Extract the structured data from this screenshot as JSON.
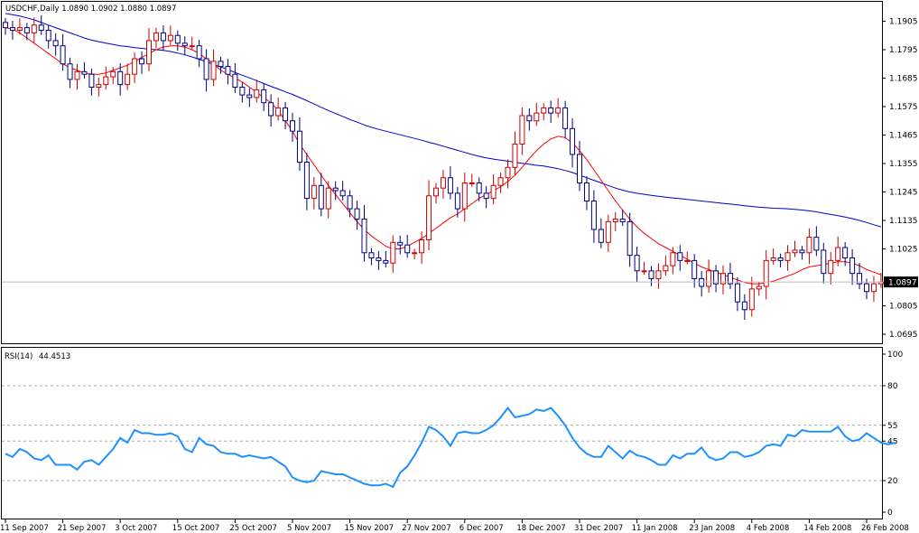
{
  "chart_data": [
    {
      "type": "candlestick",
      "symbol_line": "USDCHF,Daily  1.0890 1.0902 1.0880 1.0897",
      "ylim": [
        1.066,
        1.198
      ],
      "y_ticks": [
        "1.1905",
        "1.1795",
        "1.1685",
        "1.1575",
        "1.1465",
        "1.1355",
        "1.1245",
        "1.1135",
        "1.1025",
        "1.0805",
        "1.0695"
      ],
      "current_price_label": "1.0897",
      "current_price": 1.0897,
      "x_tick_labels": [
        {
          "label": "11 Sep 2007",
          "bar": 0
        },
        {
          "label": "21 Sep 2007",
          "bar": 8
        },
        {
          "label": "3 Oct 2007",
          "bar": 16
        },
        {
          "label": "15 Oct 2007",
          "bar": 24
        },
        {
          "label": "25 Oct 2007",
          "bar": 32
        },
        {
          "label": "5 Nov 2007",
          "bar": 40
        },
        {
          "label": "15 Nov 2007",
          "bar": 48
        },
        {
          "label": "27 Nov 2007",
          "bar": 56
        },
        {
          "label": "6 Dec 2007",
          "bar": 64
        },
        {
          "label": "18 Dec 2007",
          "bar": 72
        },
        {
          "label": "31 Dec 2007",
          "bar": 80
        },
        {
          "label": "11 Jan 2008",
          "bar": 88
        },
        {
          "label": "23 Jan 2008",
          "bar": 96
        },
        {
          "label": "4 Feb 2008",
          "bar": 104
        },
        {
          "label": "14 Feb 2008",
          "bar": 112
        },
        {
          "label": "26 Feb 2008",
          "bar": 120
        }
      ],
      "close": [
        1.188,
        1.187,
        1.188,
        1.186,
        1.189,
        1.187,
        1.183,
        1.181,
        1.174,
        1.168,
        1.171,
        1.17,
        1.165,
        1.166,
        1.169,
        1.171,
        1.166,
        1.17,
        1.176,
        1.174,
        1.183,
        1.186,
        1.183,
        1.185,
        1.182,
        1.181,
        1.181,
        1.176,
        1.168,
        1.175,
        1.173,
        1.17,
        1.165,
        1.162,
        1.161,
        1.164,
        1.159,
        1.154,
        1.157,
        1.152,
        1.148,
        1.136,
        1.122,
        1.127,
        1.118,
        1.126,
        1.125,
        1.123,
        1.118,
        1.114,
        1.101,
        1.099,
        1.098,
        1.097,
        1.105,
        1.104,
        1.101,
        1.101,
        1.106,
        1.123,
        1.126,
        1.13,
        1.124,
        1.118,
        1.128,
        1.128,
        1.124,
        1.122,
        1.127,
        1.13,
        1.134,
        1.143,
        1.154,
        1.152,
        1.155,
        1.157,
        1.155,
        1.157,
        1.149,
        1.139,
        1.128,
        1.121,
        1.11,
        1.105,
        1.113,
        1.114,
        1.113,
        1.1,
        1.094,
        1.094,
        1.091,
        1.094,
        1.096,
        1.101,
        1.098,
        1.098,
        1.091,
        1.088,
        1.094,
        1.089,
        1.093,
        1.089,
        1.082,
        1.079,
        1.087,
        1.088,
        1.098,
        1.099,
        1.098,
        1.101,
        1.102,
        1.101,
        1.107,
        1.102,
        1.093,
        1.098,
        1.103,
        1.099,
        1.093,
        1.089,
        1.086,
        1.089,
        1.0897
      ],
      "series": [
        {
          "name": "MA fast",
          "color": "#ff0000",
          "values": [
            1.188,
            1.1875,
            1.186,
            1.184,
            1.182,
            1.18,
            1.178,
            1.176,
            1.174,
            1.1725,
            1.1715,
            1.1705,
            1.17,
            1.17,
            1.1705,
            1.1715,
            1.1725,
            1.1735,
            1.175,
            1.1765,
            1.178,
            1.1795,
            1.1805,
            1.181,
            1.181,
            1.1805,
            1.1795,
            1.178,
            1.176,
            1.174,
            1.1715,
            1.17,
            1.1685,
            1.167,
            1.165,
            1.163,
            1.161,
            1.159,
            1.156,
            1.152,
            1.148,
            1.143,
            1.139,
            1.135,
            1.131,
            1.127,
            1.1235,
            1.12,
            1.1165,
            1.113,
            1.11,
            1.1075,
            1.1055,
            1.1035,
            1.1025,
            1.1025,
            1.1035,
            1.105,
            1.1065,
            1.1085,
            1.1105,
            1.1125,
            1.1145,
            1.116,
            1.118,
            1.12,
            1.122,
            1.1235,
            1.125,
            1.1265,
            1.1285,
            1.131,
            1.134,
            1.1375,
            1.1405,
            1.143,
            1.145,
            1.146,
            1.1455,
            1.1435,
            1.1405,
            1.137,
            1.133,
            1.129,
            1.125,
            1.121,
            1.1175,
            1.114,
            1.111,
            1.1085,
            1.1065,
            1.1045,
            1.103,
            1.1015,
            1.1,
            1.0985,
            1.097,
            1.0955,
            1.0945,
            1.0935,
            1.0925,
            1.0915,
            1.0905,
            1.0895,
            1.089,
            1.089,
            1.0895,
            1.09,
            1.091,
            1.092,
            1.093,
            1.0945,
            1.0955,
            1.096,
            1.0965,
            1.097,
            1.0975,
            1.0975,
            1.097,
            1.096,
            1.0945,
            1.0935,
            1.0925
          ]
        },
        {
          "name": "MA slow",
          "color": "#0000cc",
          "values": [
            1.1935,
            1.193,
            1.1925,
            1.1918,
            1.191,
            1.19,
            1.189,
            1.188,
            1.187,
            1.186,
            1.185,
            1.184,
            1.1832,
            1.1826,
            1.182,
            1.1815,
            1.181,
            1.1807,
            1.1803,
            1.18,
            1.1797,
            1.1795,
            1.1792,
            1.1788,
            1.1782,
            1.1775,
            1.1767,
            1.1758,
            1.1748,
            1.1738,
            1.1728,
            1.1718,
            1.1707,
            1.1696,
            1.1686,
            1.1675,
            1.1664,
            1.1653,
            1.1643,
            1.1632,
            1.1622,
            1.161,
            1.1598,
            1.1585,
            1.1572,
            1.156,
            1.1548,
            1.1537,
            1.1525,
            1.1515,
            1.1504,
            1.1495,
            1.1487,
            1.148,
            1.1473,
            1.1466,
            1.1459,
            1.1452,
            1.1445,
            1.1437,
            1.143,
            1.1422,
            1.1414,
            1.1406,
            1.1398,
            1.139,
            1.1383,
            1.1377,
            1.1372,
            1.1368,
            1.1364,
            1.136,
            1.1356,
            1.1352,
            1.1348,
            1.1345,
            1.134,
            1.1335,
            1.1328,
            1.132,
            1.131,
            1.13,
            1.129,
            1.128,
            1.127,
            1.126,
            1.1252,
            1.1245,
            1.124,
            1.1236,
            1.1232,
            1.1228,
            1.1225,
            1.1222,
            1.1219,
            1.1216,
            1.1213,
            1.121,
            1.1207,
            1.1204,
            1.1201,
            1.1198,
            1.1195,
            1.1192,
            1.1189,
            1.1186,
            1.1184,
            1.1182,
            1.1181,
            1.118,
            1.1178,
            1.1175,
            1.1172,
            1.1168,
            1.1163,
            1.1158,
            1.1153,
            1.1148,
            1.1142,
            1.1135,
            1.1127,
            1.1118,
            1.111
          ]
        }
      ]
    },
    {
      "type": "line",
      "label_name": "RSI(14)",
      "label_value": "44.4513",
      "ylim": [
        0,
        100
      ],
      "y_ticks": [
        "100",
        "80",
        "55",
        "45",
        "20",
        "0"
      ],
      "levels": [
        80,
        55,
        45,
        20
      ],
      "series": [
        {
          "color": "#1e90ff",
          "values": [
            37,
            35,
            40,
            38,
            34,
            33,
            36,
            30,
            30,
            30,
            27,
            32,
            33,
            30,
            35,
            40,
            47,
            44,
            52,
            50,
            50,
            49,
            49,
            50,
            48,
            40,
            38,
            47,
            43,
            42,
            38,
            37,
            37,
            35,
            36,
            35,
            34,
            35,
            32,
            29,
            22,
            20,
            19,
            20,
            26,
            25,
            24,
            24,
            22,
            20,
            18,
            17,
            17,
            18,
            16,
            25,
            29,
            36,
            44,
            54,
            52,
            48,
            42,
            50,
            51,
            50,
            50,
            52,
            55,
            60,
            66,
            60,
            61,
            62,
            65,
            64,
            66,
            61,
            55,
            47,
            41,
            37,
            35,
            35,
            42,
            38,
            34,
            39,
            36,
            35,
            33,
            30,
            30,
            36,
            34,
            37,
            37,
            41,
            35,
            33,
            34,
            38,
            38,
            35,
            36,
            38,
            42,
            43,
            42,
            49,
            48,
            52,
            51,
            51,
            51,
            51,
            54,
            48,
            45,
            46,
            50,
            47,
            44,
            43,
            44
          ]
        }
      ]
    }
  ]
}
